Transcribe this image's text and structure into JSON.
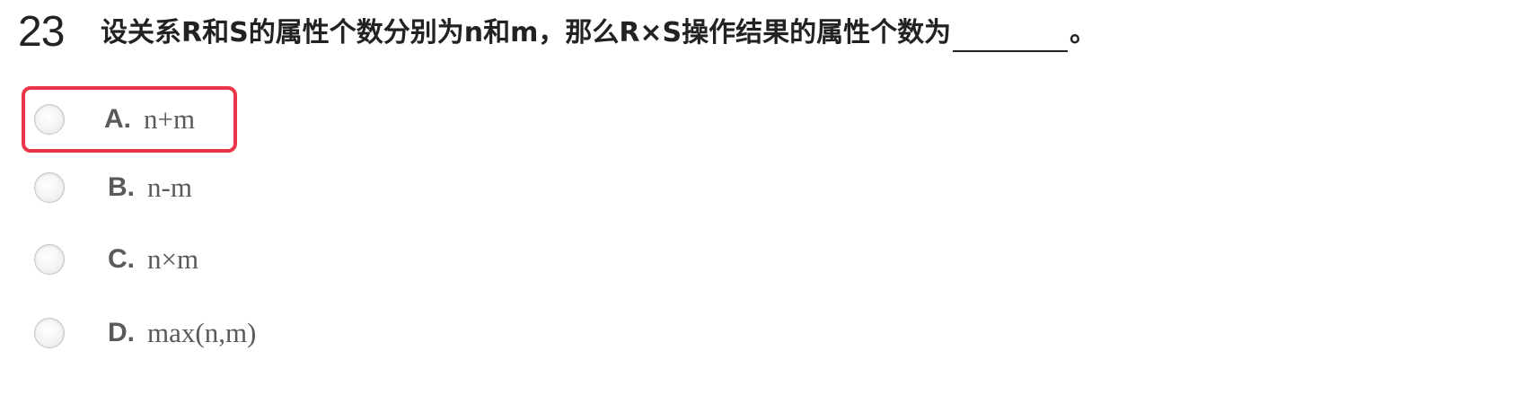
{
  "question": {
    "number": "23",
    "text_before_blank": "设关系R和S的属性个数分别为n和m，那么R×S操作结果的属性个数为",
    "text_after_blank": "。"
  },
  "options": [
    {
      "letter": "A.",
      "text": "n+m",
      "highlighted": true
    },
    {
      "letter": "B.",
      "text": "n-m",
      "highlighted": false
    },
    {
      "letter": "C.",
      "text": "n×m",
      "highlighted": false
    },
    {
      "letter": "D.",
      "text": "max(n,m)",
      "highlighted": false
    }
  ],
  "colors": {
    "highlight_border": "#e8354a",
    "question_text": "#222222",
    "option_text": "#5a5a5a"
  }
}
